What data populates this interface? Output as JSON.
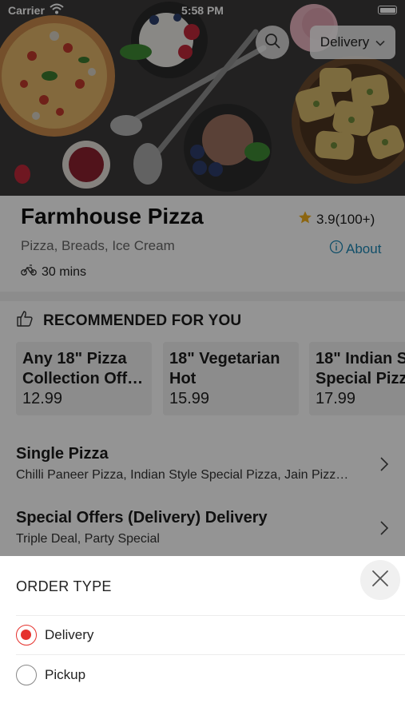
{
  "status_bar": {
    "carrier": "Carrier",
    "time": "5:58 PM"
  },
  "header": {
    "order_mode": "Delivery",
    "search_icon": "search-icon"
  },
  "restaurant": {
    "name": "Farmhouse Pizza",
    "rating": "3.9(100+)",
    "cuisines": "Pizza, Breads, Ice Cream",
    "about_label": "About",
    "delivery_time": "30 mins"
  },
  "recommended": {
    "heading": "RECOMMENDED FOR YOU",
    "items": [
      {
        "title_line1": "Any 18\" Pizza",
        "title_line2": "Collection Off…",
        "price": "12.99"
      },
      {
        "title_line1": "18\" Vegetarian",
        "title_line2": "Hot",
        "price": "15.99"
      },
      {
        "title_line1": "18\" Indian S",
        "title_line2": "Special Pizz",
        "price": "17.99"
      }
    ]
  },
  "categories": [
    {
      "title": "Single Pizza",
      "subtitle": "Chilli Paneer Pizza, Indian Style Special Pizza, Jain Pizz…"
    },
    {
      "title": "Special Offers (Delivery) Delivery",
      "subtitle": "Triple Deal, Party Special"
    }
  ],
  "order_sheet": {
    "title": "ORDER TYPE",
    "options": [
      {
        "label": "Delivery",
        "selected": true
      },
      {
        "label": "Pickup",
        "selected": false
      }
    ]
  },
  "colors": {
    "accent_red": "#e5322d",
    "link_blue": "#1e88b6",
    "star": "#f2b01e"
  }
}
